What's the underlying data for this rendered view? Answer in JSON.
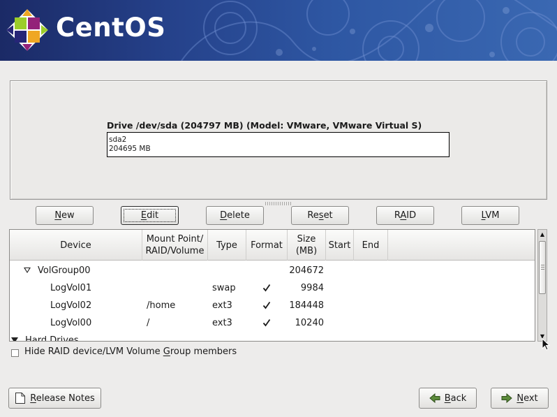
{
  "header": {
    "brand": "CentOS"
  },
  "drive": {
    "title": "Drive /dev/sda (204797 MB) (Model: VMware, VMware Virtual S)",
    "partition": {
      "name": "sda2",
      "size": "204695 MB"
    }
  },
  "toolbar": {
    "buttons": [
      {
        "label": "New",
        "mnemonic_index": 0
      },
      {
        "label": "Edit",
        "mnemonic_index": 0,
        "focused": true
      },
      {
        "label": "Delete",
        "mnemonic_index": 0
      },
      {
        "label": "Reset",
        "mnemonic_index": 2
      },
      {
        "label": "RAID",
        "mnemonic_index": 1
      },
      {
        "label": "LVM",
        "mnemonic_index": 0
      }
    ]
  },
  "table": {
    "columns": [
      {
        "line1": "Device",
        "line2": ""
      },
      {
        "line1": "Mount Point/",
        "line2": "RAID/Volume"
      },
      {
        "line1": "Type",
        "line2": ""
      },
      {
        "line1": "Format",
        "line2": ""
      },
      {
        "line1": "Size",
        "line2": "(MB)"
      },
      {
        "line1": "Start",
        "line2": ""
      },
      {
        "line1": "End",
        "line2": ""
      }
    ],
    "rows": [
      {
        "device": "VolGroup00",
        "mount": "",
        "type": "",
        "format": false,
        "size": "204672",
        "start": "",
        "end": "",
        "level": 1,
        "expanded": true
      },
      {
        "device": "LogVol01",
        "mount": "",
        "type": "swap",
        "format": true,
        "size": "9984",
        "start": "",
        "end": "",
        "level": 2
      },
      {
        "device": "LogVol02",
        "mount": "/home",
        "type": "ext3",
        "format": true,
        "size": "184448",
        "start": "",
        "end": "",
        "level": 2
      },
      {
        "device": "LogVol00",
        "mount": "/",
        "type": "ext3",
        "format": true,
        "size": "10240",
        "start": "",
        "end": "",
        "level": 2
      },
      {
        "device": "Hard Drives",
        "mount": "",
        "type": "",
        "format": false,
        "size": "",
        "start": "",
        "end": "",
        "level": 0,
        "expanded": true
      }
    ]
  },
  "options": {
    "hide_members": {
      "label_before": "Hide RAID device/LVM Volume ",
      "label_mnemonic": "G",
      "label_after": "roup members",
      "checked": false
    }
  },
  "footer": {
    "release_notes": {
      "label_mnemonic": "R",
      "label_rest": "elease Notes"
    },
    "back": {
      "label_mnemonic": "B",
      "label_rest": "ack"
    },
    "next": {
      "label_mnemonic": "N",
      "label_rest": "ext"
    }
  },
  "icons": {
    "release_notes": "document-icon",
    "back": "arrow-left-icon",
    "next": "arrow-right-icon",
    "format_check": "checkmark-icon",
    "expander": "triangle-down-icon"
  },
  "colors": {
    "banner": "#2a4a93",
    "check": "#1a1a1a",
    "background": "#edeceb"
  }
}
